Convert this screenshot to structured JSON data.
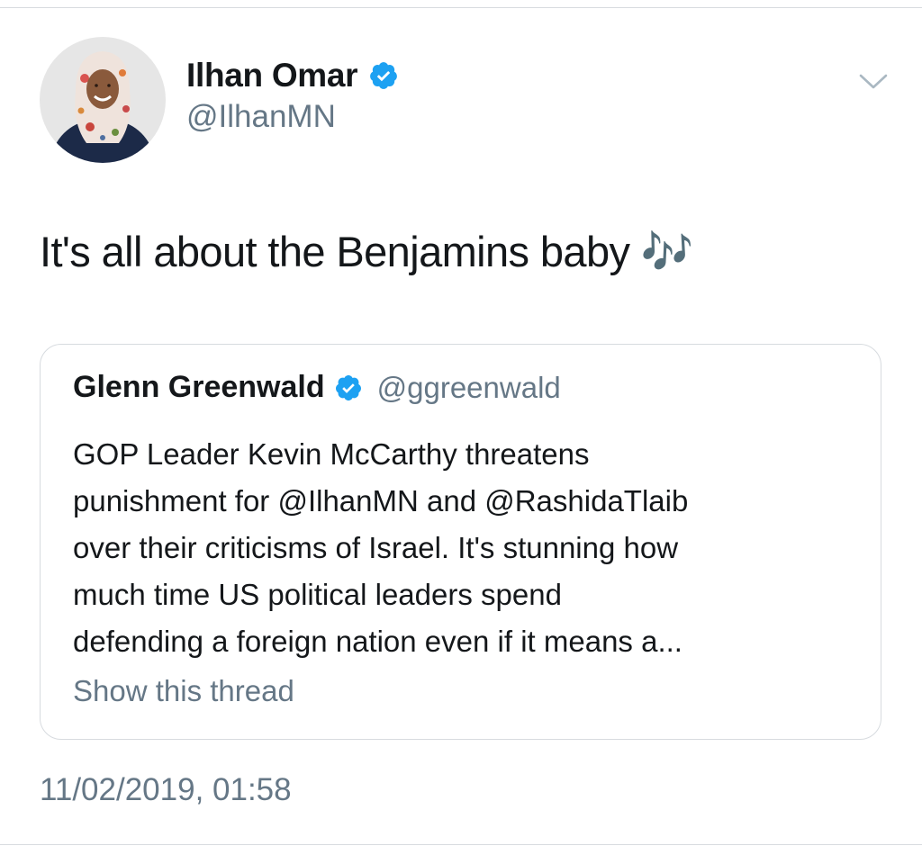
{
  "tweet": {
    "author": {
      "name": "Ilhan Omar",
      "handle": "@IlhanMN",
      "verified": true
    },
    "text": "It's all about the Benjamins baby 🎶",
    "quoted": {
      "author_name": "Glenn Greenwald",
      "author_handle": "@ggreenwald",
      "verified": true,
      "lines": [
        "GOP Leader Kevin McCarthy threatens",
        "punishment for @IlhanMN and @RashidaTlaib",
        "over their criticisms of Israel. It's stunning how",
        "much time US political leaders spend",
        "defending a foreign nation even if it means a..."
      ],
      "show_thread_label": "Show this thread"
    },
    "timestamp": "11/02/2019, 01:58"
  },
  "icons": {
    "verified": "verified-badge-icon",
    "menu": "chevron-down-icon"
  },
  "colors": {
    "text_primary": "#14171a",
    "text_secondary": "#657786",
    "verified_blue": "#1da1f2",
    "border": "#d7dbdf"
  }
}
